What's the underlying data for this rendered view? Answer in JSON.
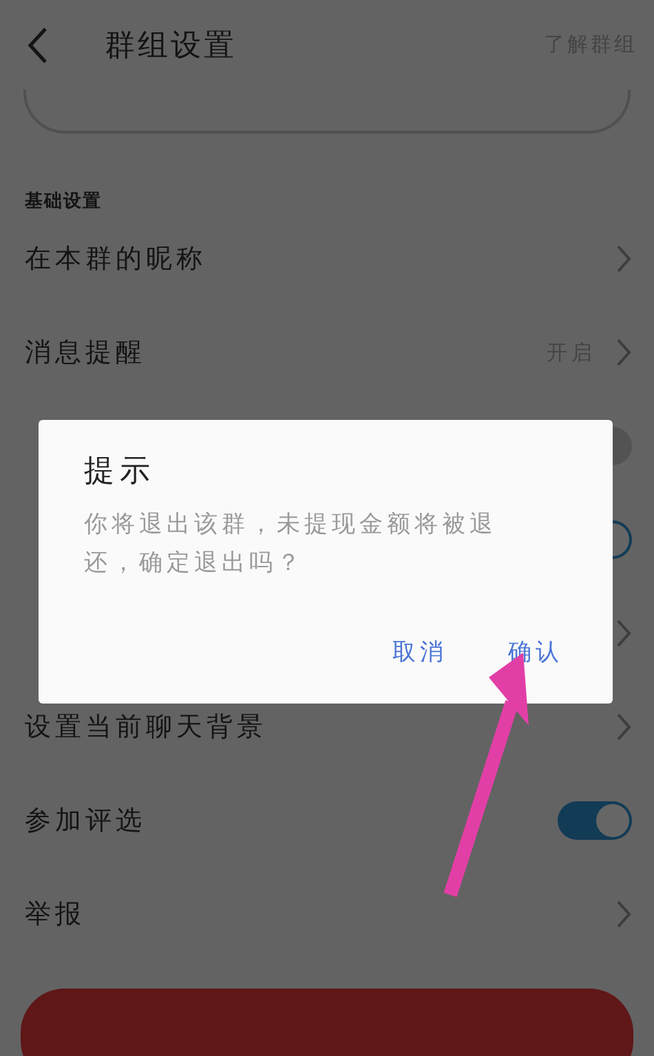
{
  "header": {
    "title": "群组设置",
    "action": "了解群组"
  },
  "section": "基础设置",
  "rows": [
    {
      "kind": "link",
      "label": "在本群的昵称"
    },
    {
      "kind": "link",
      "label": "消息提醒",
      "value": "开启"
    },
    {
      "kind": "toggle",
      "on": false
    },
    {
      "kind": "toggle",
      "on": true
    },
    {
      "kind": "link"
    },
    {
      "kind": "link",
      "label": "设置当前聊天背景"
    },
    {
      "kind": "toggle",
      "label": "参加评选",
      "on": true
    },
    {
      "kind": "link",
      "label": "举报"
    }
  ],
  "dialog": {
    "title": "提示",
    "message": "你将退出该群，未提现金额将被退还，确定退出吗？",
    "buttons": [
      "取消",
      "确认"
    ]
  }
}
